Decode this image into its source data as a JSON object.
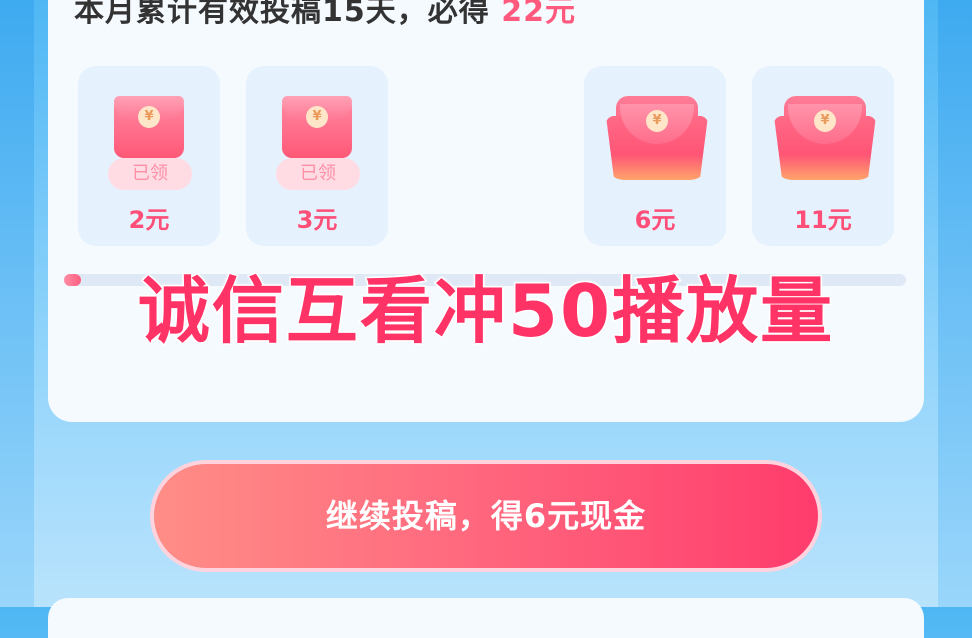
{
  "header": {
    "text_before": "本月累计有效投稿15天，必得",
    "amount": "22元"
  },
  "rewards": [
    {
      "status": "已领",
      "amount": "2元"
    },
    {
      "status": "已领",
      "amount": "3元"
    },
    {
      "status": "",
      "amount": "6元"
    },
    {
      "status": "",
      "amount": "11元"
    }
  ],
  "progress": {
    "fraction": 0.02
  },
  "overlay_text": "诚信互看冲50播放量",
  "cta": {
    "label": "继续投稿，得6元现金"
  },
  "colors": {
    "accent": "#ff4f78",
    "background": "#4fb7f4"
  }
}
